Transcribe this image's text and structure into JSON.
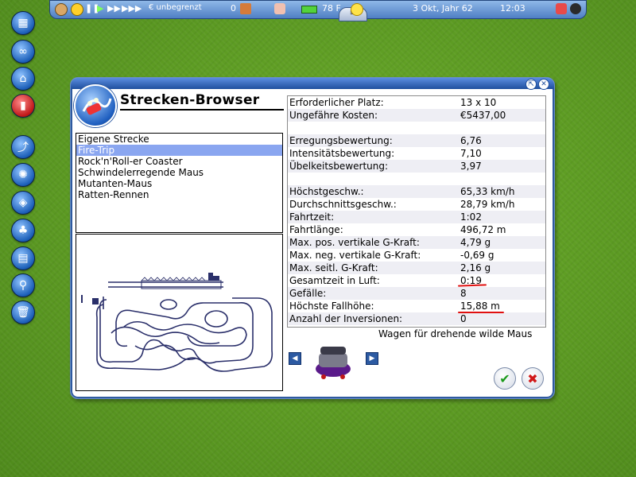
{
  "toolbar": {
    "money": "€ unbegrenzt",
    "guests": "0",
    "temperature": "78 F",
    "date": "3 Okt, Jahr 62",
    "time": "12:03",
    "menu_label": "≡"
  },
  "window": {
    "title": "Strecken-Browser",
    "pin_label": "⇱",
    "close_label": "✕"
  },
  "tracks": [
    {
      "label": "Eigene Strecke"
    },
    {
      "label": "Fire-Trip"
    },
    {
      "label": "Rock'n'Roll-er Coaster"
    },
    {
      "label": "Schwindelerregende Maus"
    },
    {
      "label": "Mutanten-Maus"
    },
    {
      "label": "Ratten-Rennen"
    }
  ],
  "selected_track": "Fire-Trip",
  "stats": [
    {
      "label": "Erforderlicher Platz:",
      "value": "13 x 10"
    },
    {
      "label": "Ungefähre Kosten:",
      "value": "€5437,00"
    },
    {
      "label": "",
      "value": ""
    },
    {
      "label": "Erregungsbewertung:",
      "value": "6,76"
    },
    {
      "label": "Intensitätsbewertung:",
      "value": "7,10"
    },
    {
      "label": "Übelkeitsbewertung:",
      "value": "3,97"
    },
    {
      "label": "",
      "value": ""
    },
    {
      "label": "Höchstgeschw.:",
      "value": "65,33 km/h"
    },
    {
      "label": "Durchschnittsgeschw.:",
      "value": "28,79 km/h"
    },
    {
      "label": "Fahrtzeit:",
      "value": "1:02"
    },
    {
      "label": "Fahrtlänge:",
      "value": "496,72 m"
    },
    {
      "label": "Max. pos. vertikale G-Kraft:",
      "value": "4,79 g"
    },
    {
      "label": "Max. neg. vertikale G-Kraft:",
      "value": "-0,69 g"
    },
    {
      "label": "Max. seitl. G-Kraft:",
      "value": "2,16 g"
    },
    {
      "label": "Gesamtzeit in Luft:",
      "value": "0:19"
    },
    {
      "label": "Gefälle:",
      "value": "8"
    },
    {
      "label": "Höchste Fallhöhe:",
      "value": "15,88 m"
    },
    {
      "label": "Anzahl der Inversionen:",
      "value": "0"
    }
  ],
  "vehicle": {
    "label": "Wagen für drehende wilde Maus",
    "prev_label": "◀",
    "next_label": "▶"
  },
  "buttons": {
    "ok_label": "✔",
    "cancel_label": "✖"
  },
  "colors": {
    "window_accent": "#2f5aa0",
    "selection": "#8aa6f0",
    "highlight_underline": "#e01010"
  }
}
